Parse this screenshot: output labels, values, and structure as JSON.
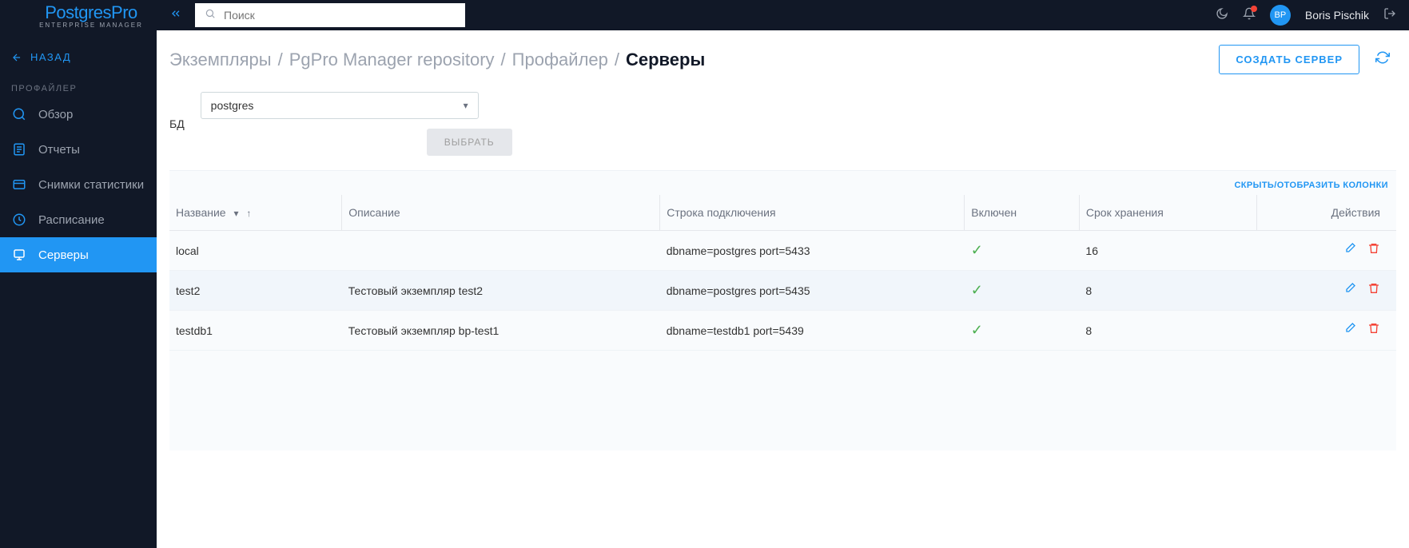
{
  "brand": {
    "name": "PostgresPro",
    "tagline": "ENTERPRISE MANAGER"
  },
  "search": {
    "placeholder": "Поиск"
  },
  "user": {
    "initials": "BP",
    "name": "Boris Pischik"
  },
  "sidebar": {
    "back_label": "НАЗАД",
    "section_label": "ПРОФАЙЛЕР",
    "items": [
      {
        "label": "Обзор"
      },
      {
        "label": "Отчеты"
      },
      {
        "label": "Снимки статистики"
      },
      {
        "label": "Расписание"
      },
      {
        "label": "Серверы"
      }
    ]
  },
  "breadcrumb": {
    "items": [
      "Экземпляры",
      "PgPro Manager repository",
      "Профайлер"
    ],
    "current": "Серверы"
  },
  "actions": {
    "create_label": "СОЗДАТЬ СЕРВЕР"
  },
  "filter": {
    "db_label": "БД",
    "db_value": "postgres",
    "select_btn": "ВЫБРАТЬ"
  },
  "table": {
    "toggle_label": "СКРЫТЬ/ОТОБРАЗИТЬ КОЛОНКИ",
    "columns": [
      "Название",
      "Описание",
      "Строка подключения",
      "Включен",
      "Срок хранения",
      "Действия"
    ],
    "rows": [
      {
        "name": "local",
        "desc": "",
        "conn": "dbname=postgres port=5433",
        "enabled": true,
        "retention": "16"
      },
      {
        "name": "test2",
        "desc": "Тестовый экземпляр test2",
        "conn": "dbname=postgres port=5435",
        "enabled": true,
        "retention": "8"
      },
      {
        "name": "testdb1",
        "desc": "Тестовый экземпляр bp-test1",
        "conn": "dbname=testdb1 port=5439",
        "enabled": true,
        "retention": "8"
      }
    ]
  }
}
